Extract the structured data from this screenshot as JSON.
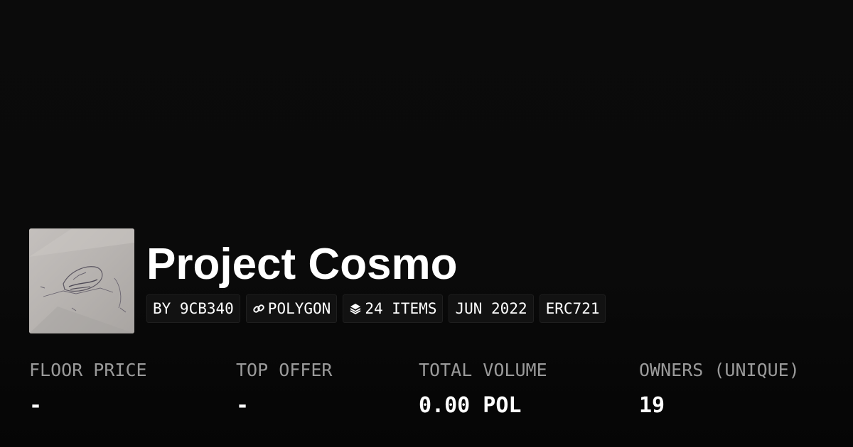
{
  "collection": {
    "title": "Project Cosmo",
    "thumbnail_alt": "collection-image"
  },
  "tags": [
    {
      "label": "BY 9CB340",
      "icon": ""
    },
    {
      "label": "POLYGON",
      "icon": "link-icon"
    },
    {
      "label": "24 ITEMS",
      "icon": "layers-icon"
    },
    {
      "label": "JUN 2022",
      "icon": ""
    },
    {
      "label": "ERC721",
      "icon": ""
    }
  ],
  "stats": [
    {
      "label": "FLOOR PRICE",
      "value": "-"
    },
    {
      "label": "TOP OFFER",
      "value": "-"
    },
    {
      "label": "TOTAL VOLUME",
      "value": "0.00 POL"
    },
    {
      "label": "OWNERS (UNIQUE)",
      "value": "19"
    }
  ],
  "colors": {
    "background": "#0b0b0b",
    "text": "#ffffff",
    "muted": "#9a9a9a",
    "tag_background": "#121212"
  }
}
